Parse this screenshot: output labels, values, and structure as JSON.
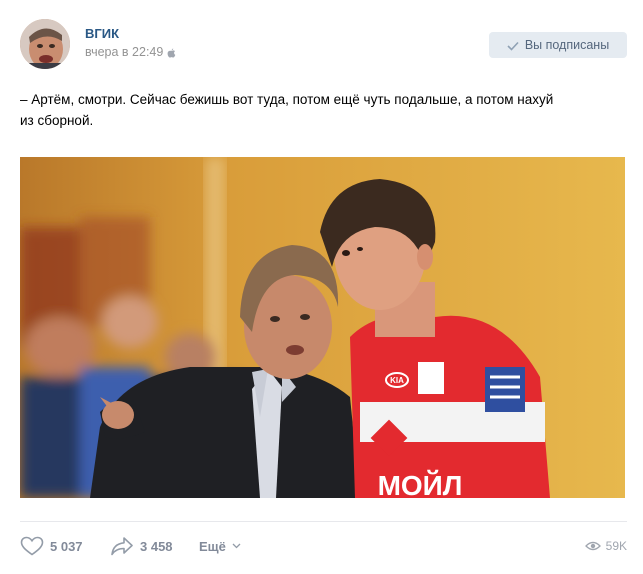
{
  "post": {
    "author": "ВГИК",
    "date": "вчера в 22:49",
    "platform_icon": "apple-icon",
    "subscribe_label": "Вы подписаны",
    "text_line1": "– Артём, смотри. Сейчас бежишь вот туда, потом ещё чуть подальше, а потом нахуй",
    "text_line2": "из сборной.",
    "jersey_text": "МОЙЛ",
    "kia_text": "KIA"
  },
  "footer": {
    "likes": "5 037",
    "shares": "3 458",
    "more_label": "Ещё",
    "views": "59K"
  },
  "colors": {
    "link": "#2a5885",
    "button_bg": "#e5ebf1",
    "button_text": "#55677d",
    "muted": "#828a99"
  }
}
